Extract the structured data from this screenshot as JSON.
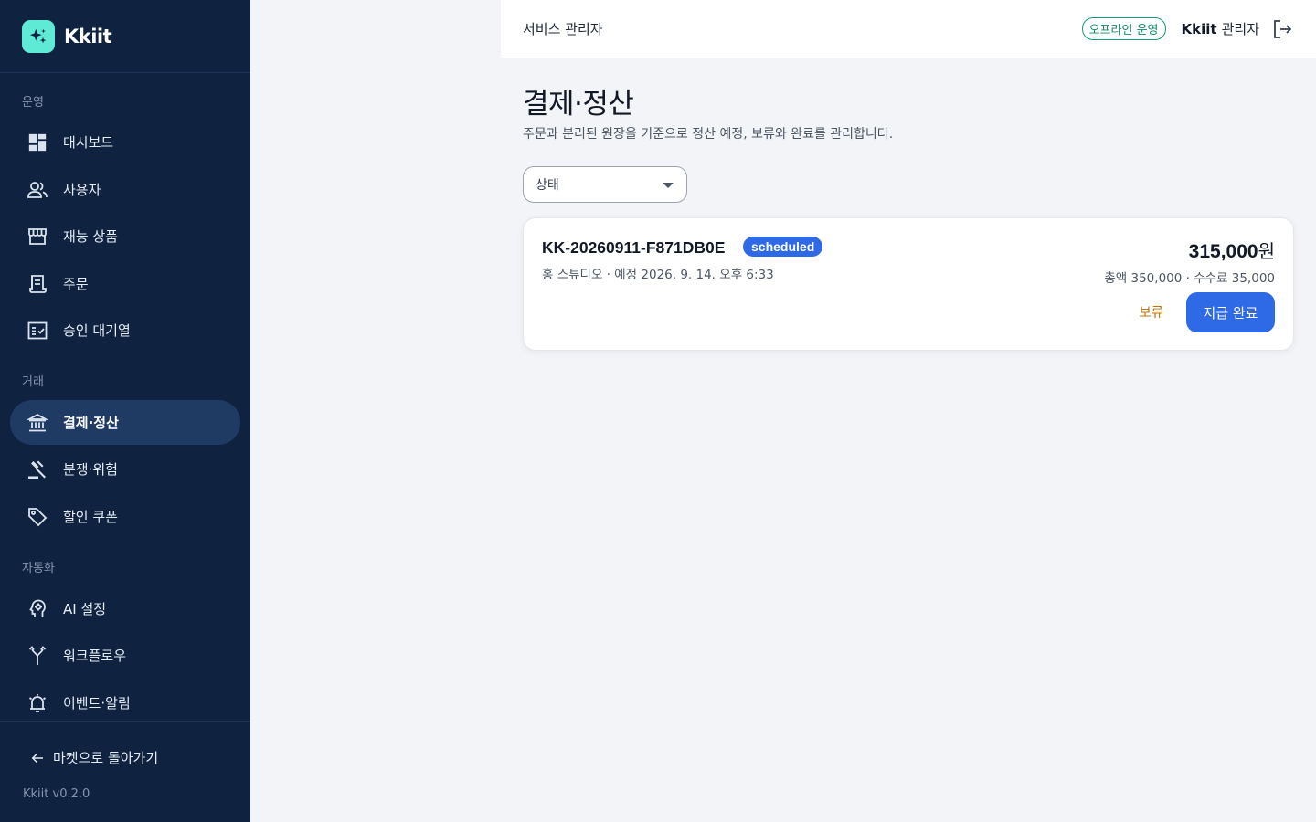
{
  "brand": {
    "name": "Kkiit"
  },
  "sidebar": {
    "sections": [
      {
        "label": "운영"
      },
      {
        "label": "거래"
      },
      {
        "label": "자동화"
      }
    ],
    "items": [
      {
        "label": "대시보드",
        "icon": "dashboard-icon"
      },
      {
        "label": "사용자",
        "icon": "users-icon"
      },
      {
        "label": "재능 상품",
        "icon": "store-icon"
      },
      {
        "label": "주문",
        "icon": "receipt-icon"
      },
      {
        "label": "승인 대기열",
        "icon": "checklist-icon"
      },
      {
        "label": "결제·정산",
        "icon": "bank-icon",
        "active": true
      },
      {
        "label": "분쟁·위험",
        "icon": "gavel-icon"
      },
      {
        "label": "할인 쿠폰",
        "icon": "tag-icon"
      },
      {
        "label": "AI 설정",
        "icon": "ai-head-icon"
      },
      {
        "label": "워크플로우",
        "icon": "workflow-icon"
      },
      {
        "label": "이벤트·알림",
        "icon": "alarm-icon"
      }
    ],
    "back_label": "마켓으로 돌아가기",
    "version": "Kkiit v0.2.0"
  },
  "header": {
    "title": "서비스 관리자",
    "offline_badge": "오프라인 운영",
    "admin_name": "Kkiit",
    "admin_role": "관리자"
  },
  "main": {
    "title": "결제·정산",
    "description": "주문과 분리된 원장을 기준으로 정산 예정, 보류와 완료를 관리합니다.",
    "filter": {
      "label": "상태"
    },
    "settlements": [
      {
        "order_id": "KK-20260911-F871DB0E",
        "status": "scheduled",
        "meta": "홍 스튜디오 · 예정 2026. 9. 14. 오후 6:33",
        "amount": "315,000",
        "amount_unit": "원",
        "breakdown": "총액 350,000 · 수수료 35,000",
        "hold_label": "보류",
        "pay_label": "지급 완료"
      }
    ]
  },
  "colors": {
    "sidebar_bg": "#0f2340",
    "active_item_bg": "#1f3a63",
    "accent_blue": "#2f6ae6",
    "brand_teal": "#5eead4",
    "hold_orange": "#c2760a",
    "offline_green": "#0f8a6a"
  }
}
